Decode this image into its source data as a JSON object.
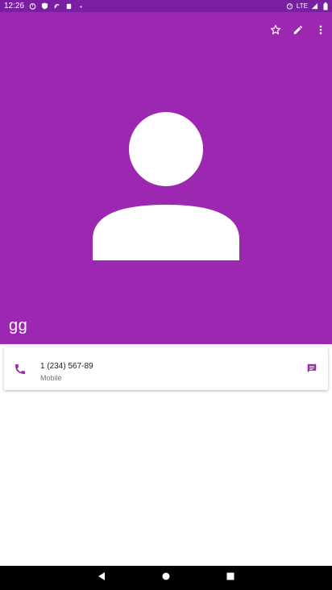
{
  "status_bar": {
    "time": "12:26",
    "network": "LTE",
    "left_icons": [
      "timer-icon",
      "shield-icon",
      "sync-icon",
      "notification-icon",
      "dot-icon"
    ],
    "right_icons": [
      "alarm-icon",
      "signal-icon",
      "battery-icon"
    ]
  },
  "header": {
    "background": "#9c27b0",
    "actions": [
      "star-icon",
      "edit-icon",
      "more-vert-icon"
    ]
  },
  "contact": {
    "name": "gg"
  },
  "phone_entry": {
    "number": "1 (234) 567-89",
    "type": "Mobile",
    "accent": "#9c27b0"
  },
  "nav": {
    "buttons": [
      "back-icon",
      "home-icon",
      "recents-icon"
    ]
  }
}
